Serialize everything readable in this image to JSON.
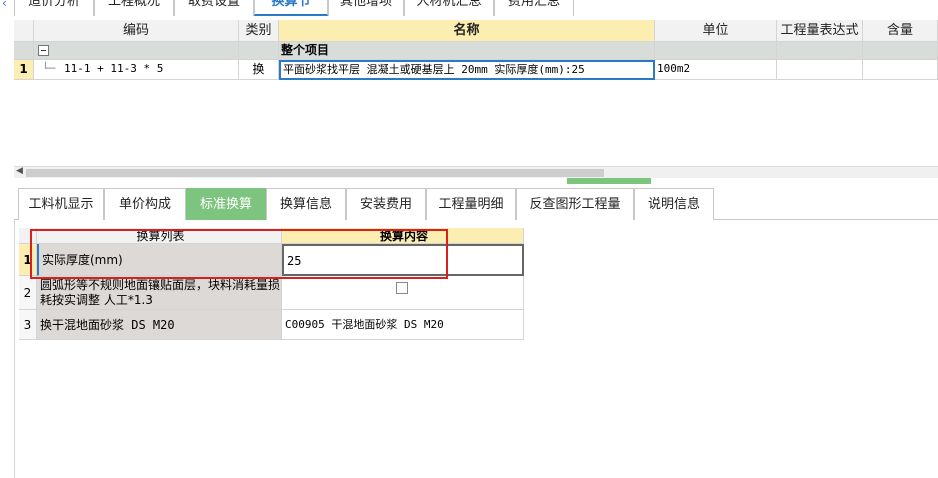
{
  "top_tabs": [
    {
      "label": "造价分析"
    },
    {
      "label": "工程概况"
    },
    {
      "label": "取费设置"
    },
    {
      "label": "换算节"
    },
    {
      "label": "其他增项"
    },
    {
      "label": "人材机汇总"
    },
    {
      "label": "费用汇总"
    }
  ],
  "upper_grid": {
    "headers": [
      "编码",
      "类别",
      "名称",
      "单位",
      "工程量表达式",
      "含量"
    ],
    "group_row": {
      "name": "整个项目"
    },
    "rows": [
      {
        "num": "1",
        "code": "11-1 + 11-3 * 5",
        "type": "换",
        "name": "平面砂浆找平层 混凝土或硬基层上 20mm  实际厚度(mm):25",
        "unit": "100m2",
        "expr": "",
        "content": ""
      }
    ]
  },
  "lower_tabs": [
    {
      "label": "工料机显示"
    },
    {
      "label": "单价构成"
    },
    {
      "label": "标准换算",
      "active": true
    },
    {
      "label": "换算信息"
    },
    {
      "label": "安装费用"
    },
    {
      "label": "工程量明细"
    },
    {
      "label": "反查图形工程量"
    },
    {
      "label": "说明信息"
    }
  ],
  "lower_grid": {
    "headers": [
      "换算列表",
      "换算内容"
    ],
    "rows": [
      {
        "num": "1",
        "name": "实际厚度(mm)",
        "value": "25"
      },
      {
        "num": "2",
        "name": "圆弧形等不规则地面镶贴面层，块料消耗量损耗按实调整 人工*1.3",
        "value": ""
      },
      {
        "num": "3",
        "name": "换干混地面砂浆 DS M20",
        "value": "C00905  干混地面砂浆 DS M20"
      }
    ]
  },
  "colors": {
    "accent_green": "#7dc47e",
    "highlight_yellow": "#fbeeb0",
    "annotation_red": "#d92020"
  }
}
